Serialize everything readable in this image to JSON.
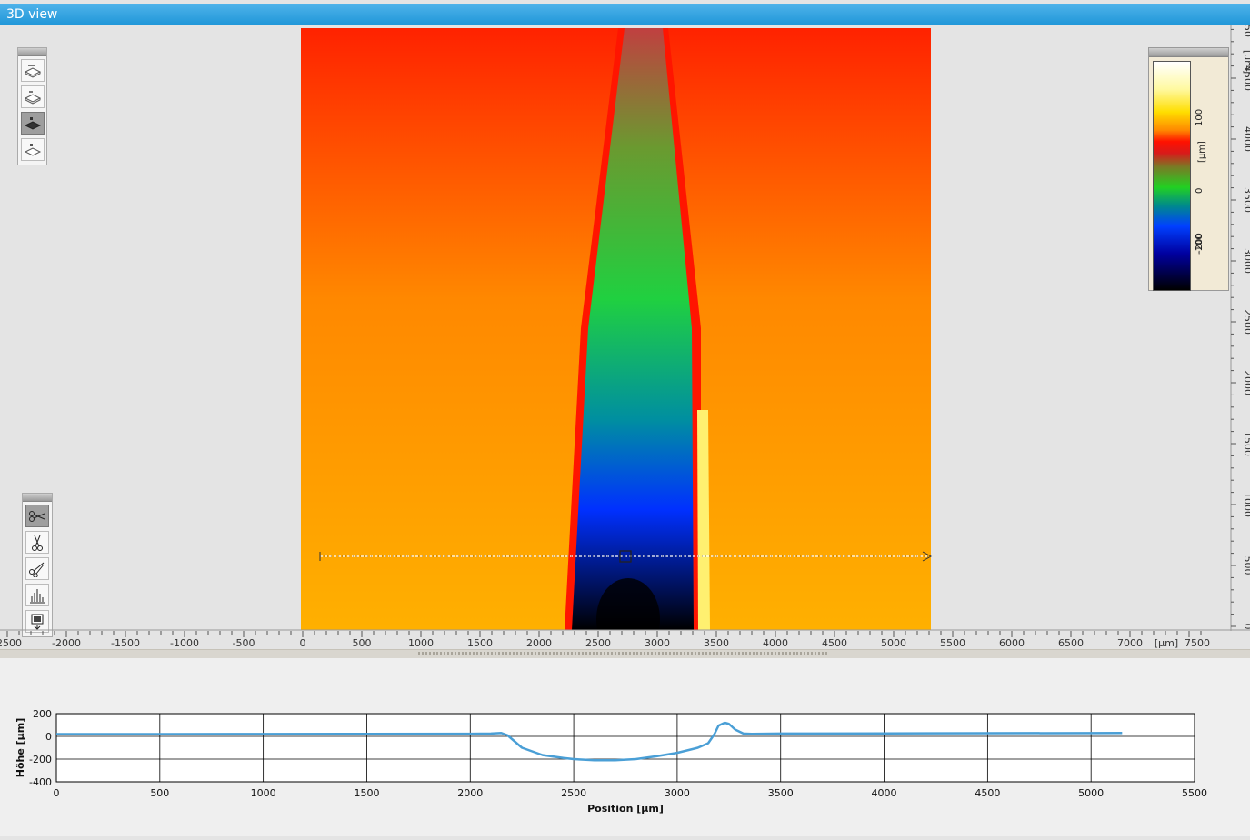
{
  "window": {
    "title": "3D view"
  },
  "view_toolbar": {
    "icons": [
      "3d-view-icon",
      "3d-view-alt-icon",
      "top-view-filled-icon",
      "top-view-outline-icon"
    ],
    "active_index": 2
  },
  "profile_toolbar": {
    "icons": [
      "scissors-horizontal-icon",
      "scissors-vertical-icon",
      "scissors-diagonal-icon",
      "histogram-icon",
      "export-icon"
    ],
    "active_index": 0
  },
  "color_scale": {
    "ticks": [
      "100",
      "0",
      "-100",
      "-200"
    ],
    "unit": "[µm]",
    "colors": [
      "#ffffff",
      "#fff9a0",
      "#ffde00",
      "#ff8800",
      "#ff1100",
      "#7a7a25",
      "#22d022",
      "#0040ff",
      "#0000a0",
      "#000000"
    ]
  },
  "x_ruler": {
    "labels": [
      "-2500",
      "-2000",
      "-1500",
      "-1000",
      "-500",
      "0",
      "500",
      "1000",
      "1500",
      "2000",
      "2500",
      "3000",
      "3500",
      "4000",
      "4500",
      "5000",
      "5500",
      "6000",
      "6500",
      "7000",
      "[µm]",
      "7500"
    ]
  },
  "y_ruler": {
    "labels": [
      "0",
      "500",
      "1000",
      "1500",
      "2000",
      "2500",
      "3000",
      "3500",
      "4000",
      "4500",
      "[µm]",
      "50"
    ]
  },
  "chart_data": {
    "type": "line",
    "xlabel": "Position [µm]",
    "ylabel": "Höhe [µm]",
    "xlim": [
      0,
      5500
    ],
    "ylim": [
      -400,
      200
    ],
    "xticks": [
      "0",
      "500",
      "1000",
      "1500",
      "2000",
      "2500",
      "3000",
      "3500",
      "4000",
      "4500",
      "5000",
      "5500"
    ],
    "yticks": [
      "200",
      "0",
      "-200",
      "-400"
    ],
    "grid": true,
    "series_color": "#4a9fd6",
    "series": [
      {
        "x": [
          0,
          500,
          1000,
          1500,
          2000,
          2100,
          2150,
          2180,
          2250,
          2350,
          2450,
          2500,
          2600,
          2700,
          2800,
          2900,
          3000,
          3100,
          3150,
          3180,
          3200,
          3230,
          3250,
          3280,
          3320,
          3360,
          3500,
          4000,
          4500,
          5000,
          5150
        ],
        "y": [
          20,
          20,
          21,
          22,
          23,
          25,
          30,
          10,
          -100,
          -165,
          -190,
          -200,
          -210,
          -210,
          -200,
          -175,
          -145,
          -100,
          -60,
          20,
          95,
          120,
          110,
          60,
          25,
          22,
          25,
          26,
          28,
          29,
          30
        ]
      }
    ]
  }
}
